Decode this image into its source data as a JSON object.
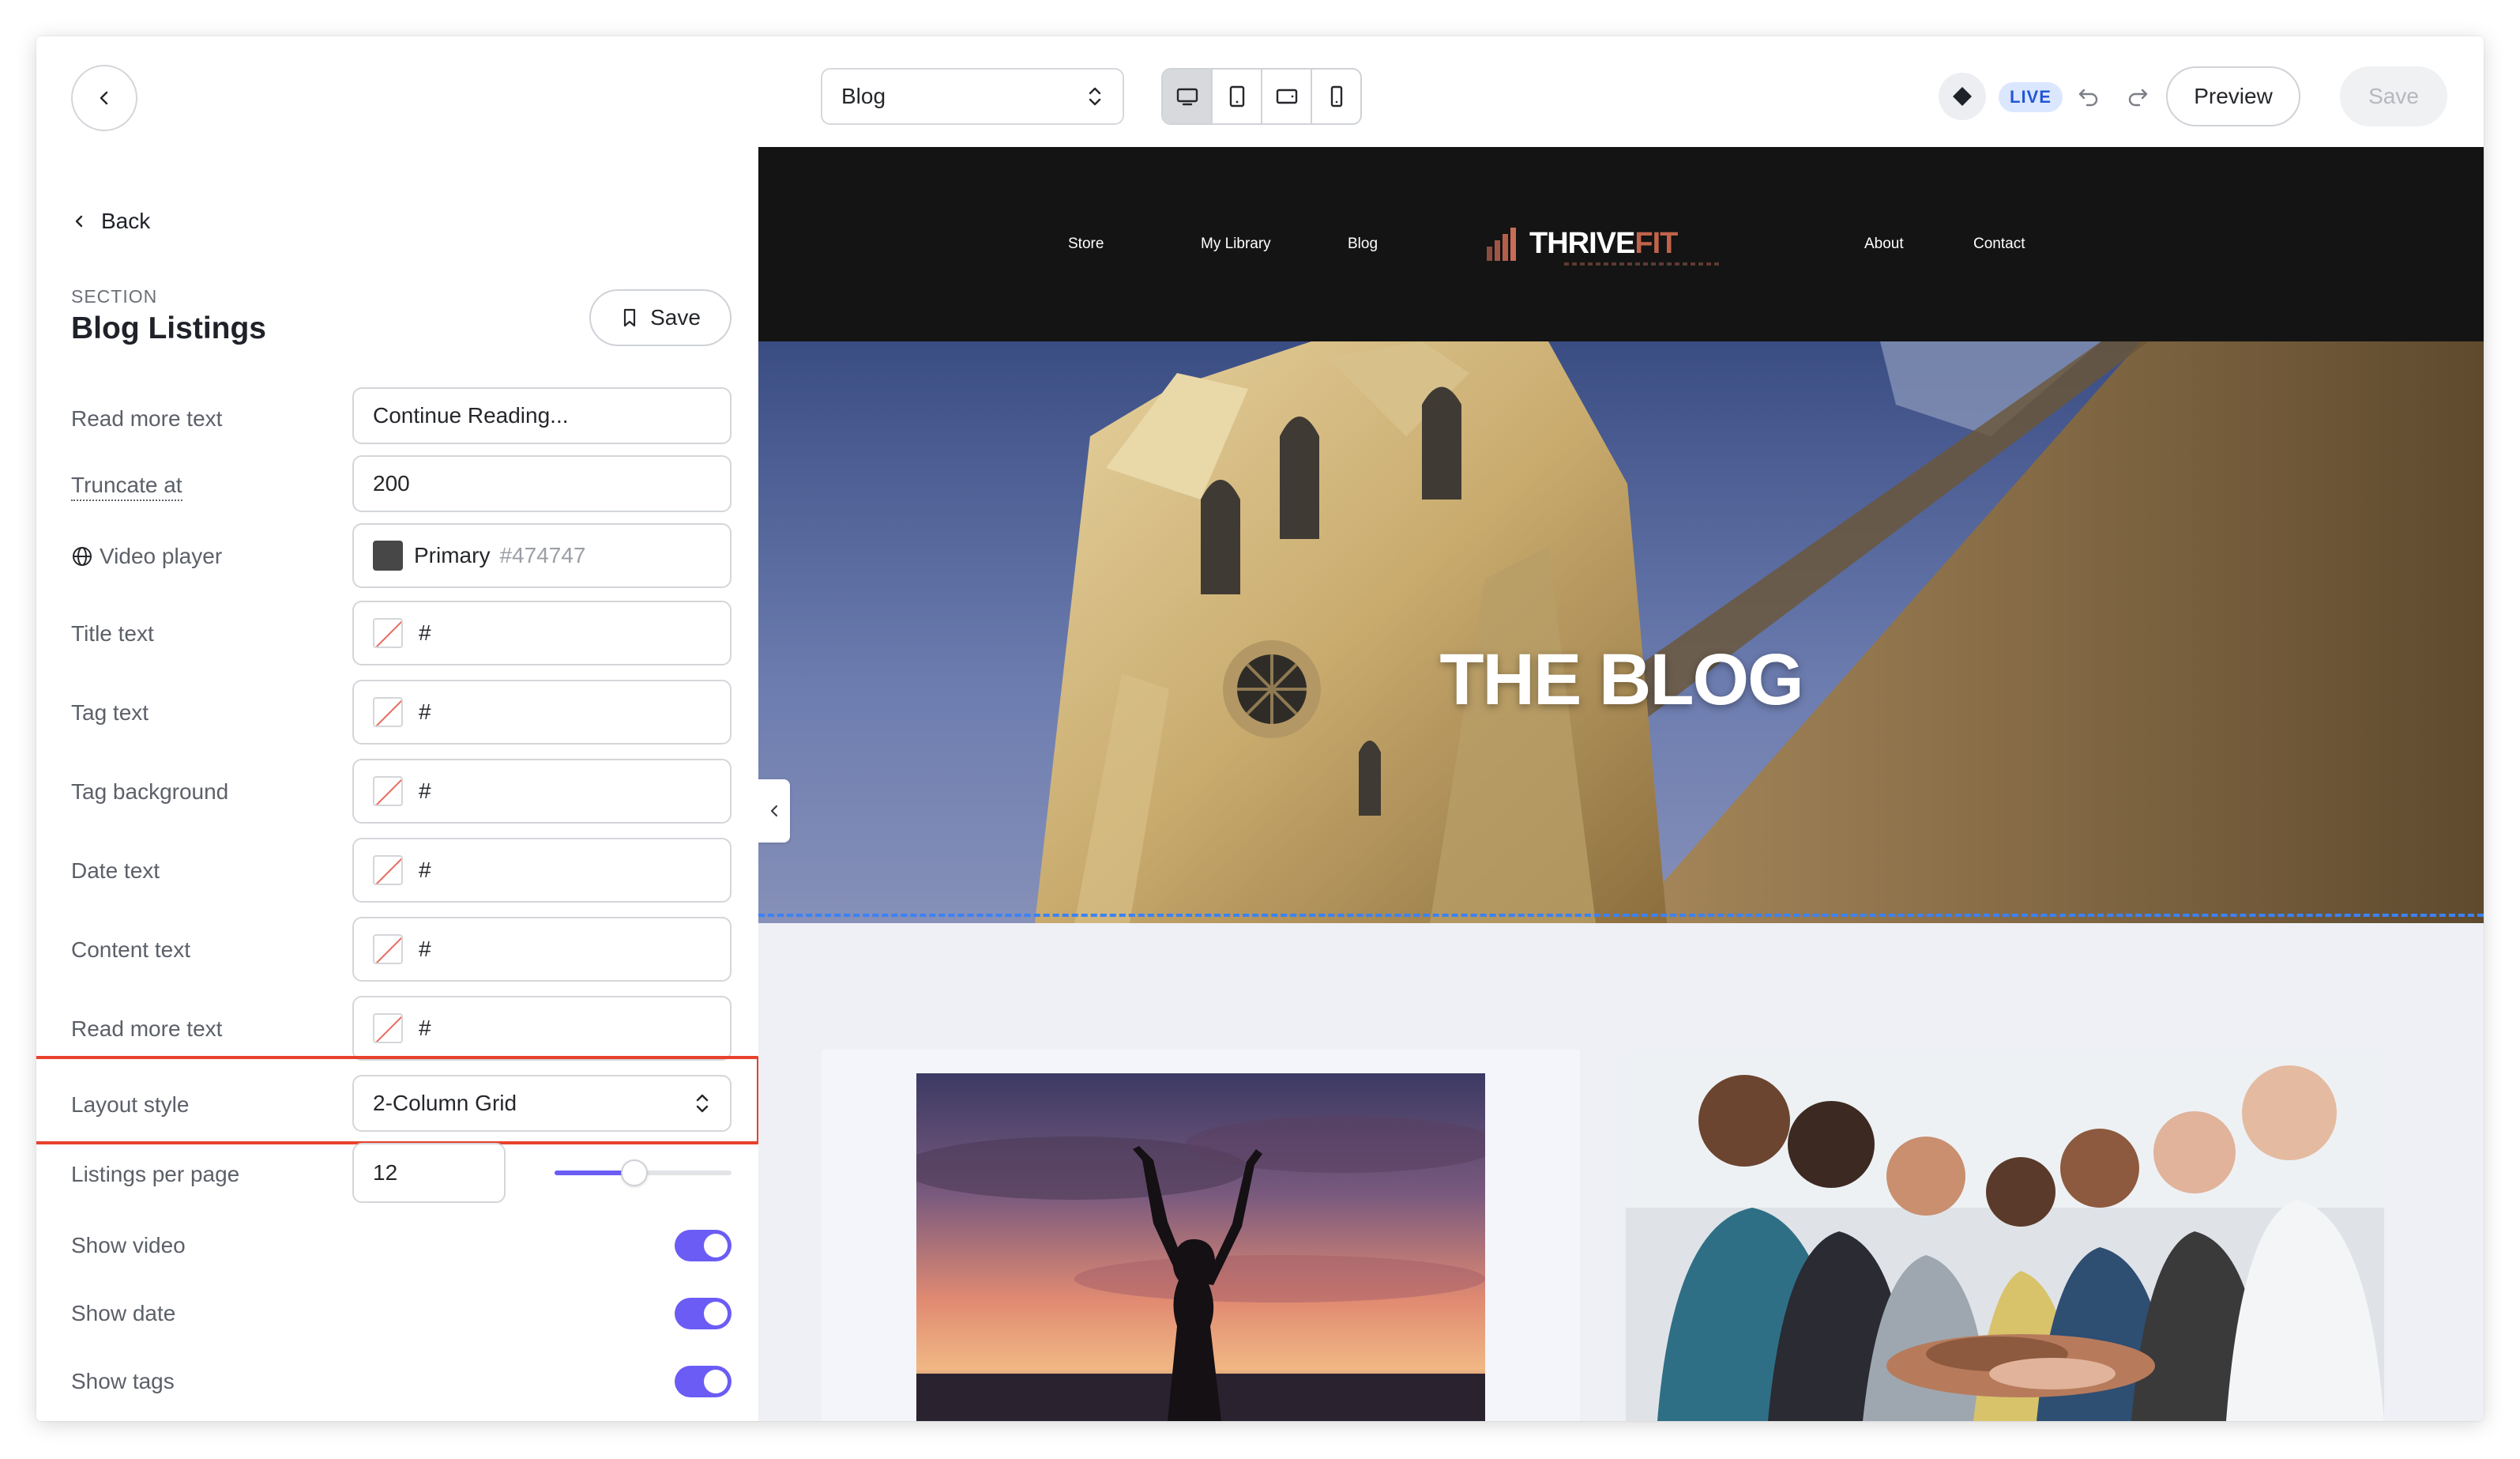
{
  "topbar": {
    "page_select": "Blog",
    "live_badge": "LIVE",
    "preview_label": "Preview",
    "save_label": "Save"
  },
  "panel": {
    "back_label": "Back",
    "section_label": "SECTION",
    "section_title": "Blog Listings",
    "save_chip": "Save",
    "rows": {
      "read_more_text": {
        "label": "Read more text",
        "value": "Continue Reading..."
      },
      "truncate_at": {
        "label": "Truncate at",
        "value": "200"
      },
      "video_player": {
        "label": "Video player",
        "color_name": "Primary",
        "color_hex": "#474747"
      },
      "title_text": {
        "label": "Title text",
        "value": "#"
      },
      "tag_text": {
        "label": "Tag text",
        "value": "#"
      },
      "tag_background": {
        "label": "Tag background",
        "value": "#"
      },
      "date_text": {
        "label": "Date text",
        "value": "#"
      },
      "content_text": {
        "label": "Content text",
        "value": "#"
      },
      "read_more_color": {
        "label": "Read more text",
        "value": "#"
      },
      "layout_style": {
        "label": "Layout style",
        "value": "2-Column Grid"
      },
      "listings_per_page": {
        "label": "Listings per page",
        "value": "12",
        "slider_fraction": 0.45
      },
      "show_video": {
        "label": "Show video",
        "on": true
      },
      "show_date": {
        "label": "Show date",
        "on": true
      },
      "show_tags": {
        "label": "Show tags",
        "on": true
      }
    }
  },
  "site": {
    "nav": [
      "Store",
      "My Library",
      "Blog",
      "About",
      "Contact"
    ],
    "logo_main": "THRIVE",
    "logo_accent": "FIT",
    "hero_title": "THE BLOG"
  },
  "colors": {
    "accent": "#6b5cf6",
    "live_bg": "#dbe7ff",
    "live_text": "#2457d6",
    "highlight": "#e8412c",
    "logo_accent": "#c1634a",
    "video_player": "#474747"
  }
}
